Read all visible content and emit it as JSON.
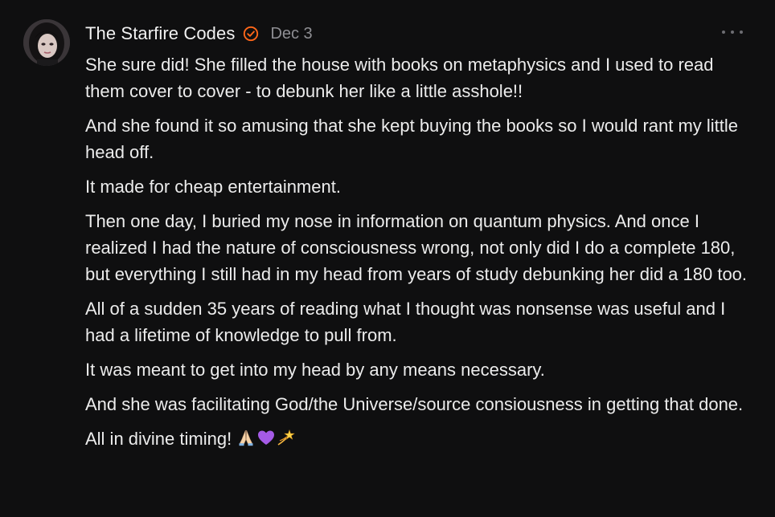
{
  "comment": {
    "author": "The Starfire Codes",
    "date": "Dec 3",
    "verified_icon": "verified-check-icon",
    "more_icon": "more-options-icon",
    "colors": {
      "background": "#0f0f10",
      "text": "#ececec",
      "muted": "#8e8e93",
      "accent": "#ff6719"
    },
    "paragraphs": [
      "She sure did! She filled the house with books on metaphysics and I used to read them cover to cover - to debunk her like a little asshole!!",
      "And she found it so amusing that she kept buying the books so I would rant my little head off.",
      "It made for cheap entertainment.",
      "Then one day, I buried my nose in information on quantum physics. And once I realized I had the nature of consciousness wrong, not only did I do a complete 180, but everything I still had in my head from years of study debunking her did a 180 too.",
      "All of a sudden 35 years of reading what I thought was nonsense was useful and I had a lifetime of knowledge to pull from.",
      "It was meant to get into my head by any means necessary.",
      "And she was facilitating God/the Universe/source consiousness in getting that done.",
      "All in divine timing!"
    ],
    "closing_emojis": [
      "folded-hands-icon",
      "purple-heart-icon",
      "dizzy-star-icon"
    ]
  }
}
